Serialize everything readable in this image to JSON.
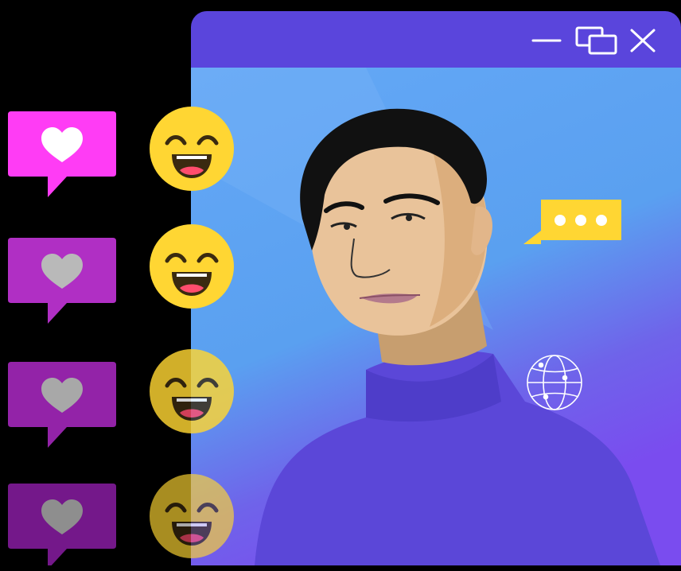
{
  "window": {
    "controls": [
      {
        "name": "minimize-icon"
      },
      {
        "name": "restore-icon"
      },
      {
        "name": "close-icon"
      }
    ],
    "titlebar_color": "#5a45dc"
  },
  "reactions": [
    {
      "icon": "heart-icon",
      "bubble_color": "#ff3cf5",
      "heart_color": "#ffffff",
      "emoji_opacity": 1.0
    },
    {
      "icon": "heart-icon",
      "bubble_color": "#b02fc4",
      "heart_color": "#b9b9b9",
      "emoji_opacity": 1.0
    },
    {
      "icon": "heart-icon",
      "bubble_color": "#9323a8",
      "heart_color": "#a8a8a8",
      "emoji_opacity": 0.82
    },
    {
      "icon": "heart-icon",
      "bubble_color": "#74188a",
      "heart_color": "#8e8e8e",
      "emoji_opacity": 0.66
    }
  ],
  "emoji": {
    "icon": "laughing-face-icon",
    "color": "#ffd633"
  },
  "chat_bubble": {
    "icon": "typing-dots-icon",
    "color": "#ffd633"
  },
  "globe": {
    "icon": "globe-icon"
  },
  "illustration": {
    "subject": "man-portrait",
    "shirt_color": "#5b47d8",
    "skin_color": "#e9c39a"
  }
}
